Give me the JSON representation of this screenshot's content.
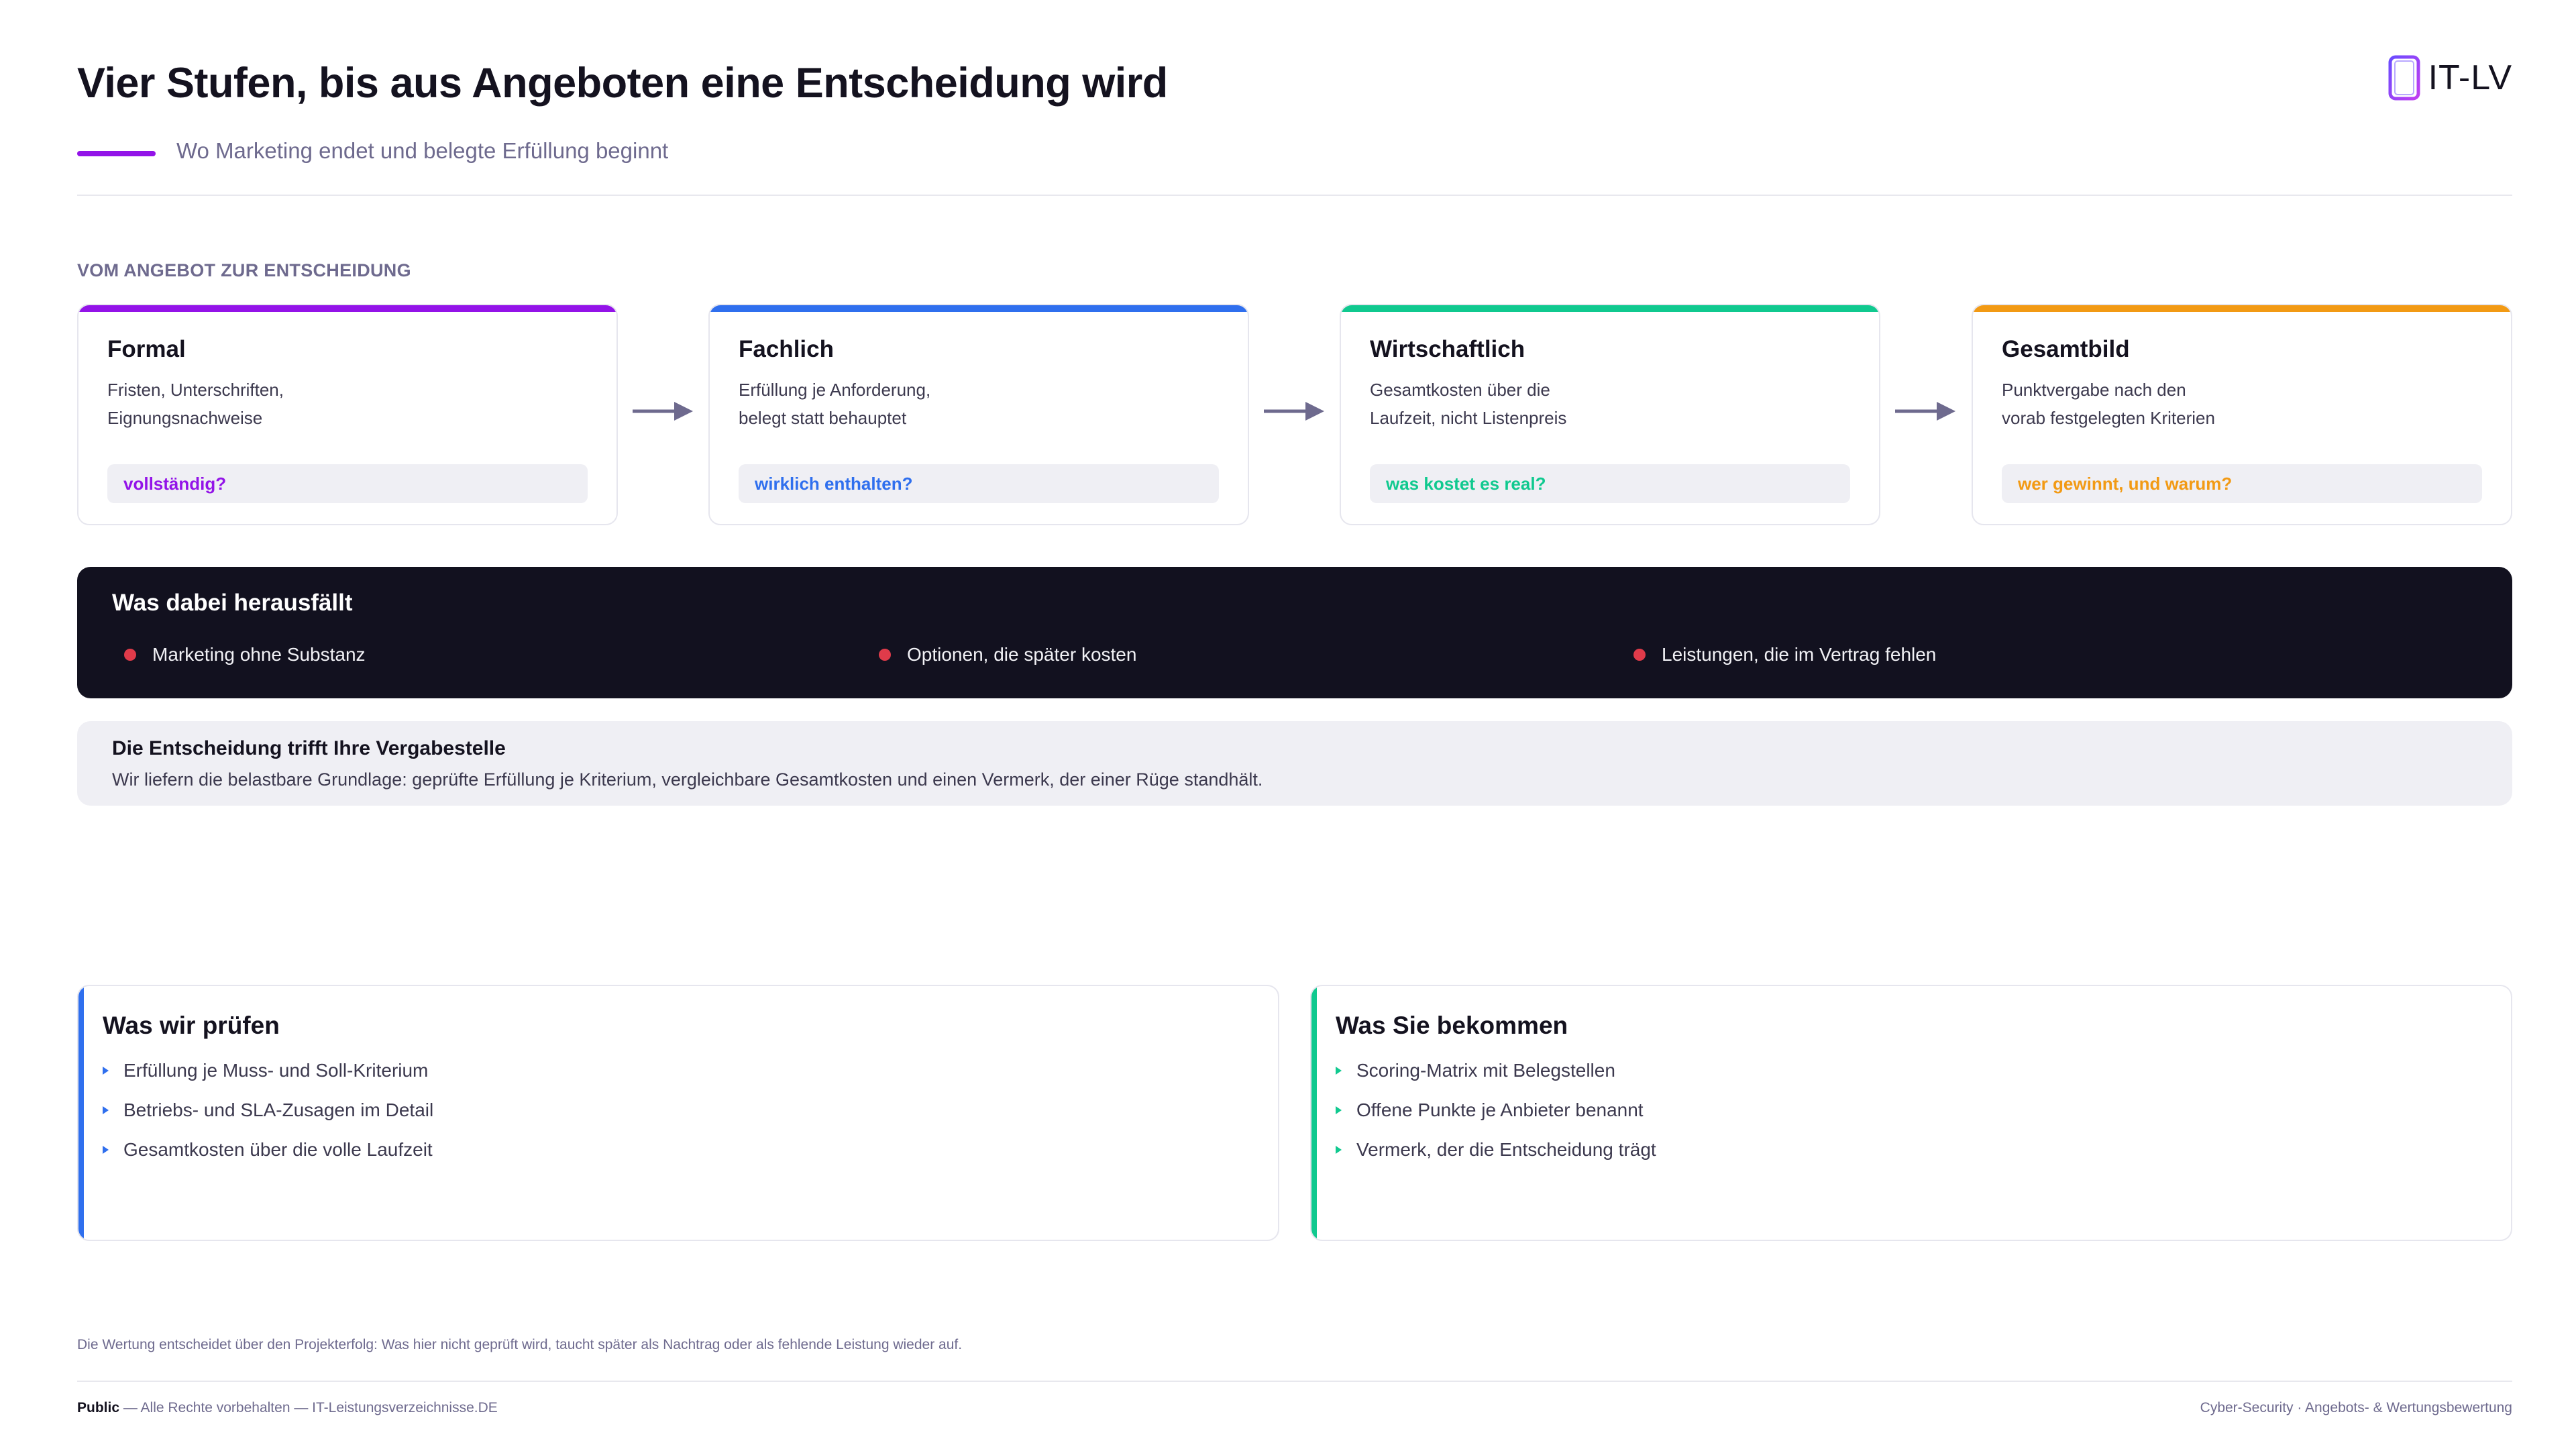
{
  "header": {
    "title": "Vier Stufen, bis aus Angeboten eine Entscheidung wird",
    "subtitle": "Wo Marketing endet und belegte Erfüllung beginnt",
    "logo_text": "IT-LV",
    "accent_color": "#9313e8"
  },
  "section_label": "VOM ANGEBOT ZUR ENTSCHEIDUNG",
  "stages": [
    {
      "title": "Formal",
      "desc_line1": "Fristen, Unterschriften,",
      "desc_line2": "Eignungsnachweise",
      "question": "vollständig?",
      "color": "#9313e8"
    },
    {
      "title": "Fachlich",
      "desc_line1": "Erfüllung je Anforderung,",
      "desc_line2": "belegt statt behauptet",
      "question": "wirklich enthalten?",
      "color": "#2f6fee"
    },
    {
      "title": "Wirtschaftlich",
      "desc_line1": "Gesamtkosten über die",
      "desc_line2": "Laufzeit, nicht Listenpreis",
      "question": "was kostet es real?",
      "color": "#10c98f"
    },
    {
      "title": "Gesamtbild",
      "desc_line1": "Punktvergabe nach den",
      "desc_line2": "vorab festgelegten Kriterien",
      "question": "wer gewinnt, und warum?",
      "color": "#f29a14"
    }
  ],
  "banner": {
    "title": "Was dabei herausfällt",
    "items": [
      "Marketing ohne Substanz",
      "Optionen, die später kosten",
      "Leistungen, die im Vertrag fehlen"
    ]
  },
  "note": {
    "title": "Die Entscheidung trifft Ihre Vergabestelle",
    "text": "Wir liefern die belastbare Grundlage: geprüfte Erfüllung je Kriterium, vergleichbare Gesamtkosten und einen Vermerk, der einer Rüge standhält."
  },
  "panels": [
    {
      "title": "Was wir prüfen",
      "color": "#2f6fee",
      "items": [
        "Erfüllung je Muss- und Soll-Kriterium",
        "Betriebs- und SLA-Zusagen im Detail",
        "Gesamtkosten über die volle Laufzeit"
      ]
    },
    {
      "title": "Was Sie bekommen",
      "color": "#10c98f",
      "items": [
        "Scoring-Matrix mit Belegstellen",
        "Offene Punkte je Anbieter benannt",
        "Vermerk, der die Entscheidung trägt"
      ]
    }
  ],
  "footnote": "Die Wertung entscheidet über den Projekterfolg: Was hier nicht geprüft wird, taucht später als Nachtrag oder als fehlende Leistung wieder auf.",
  "footer": {
    "classification": "Public",
    "left_text": " — Alle Rechte vorbehalten — IT-Leistungsverzeichnisse.DE",
    "right_text": "Cyber-Security · Angebots- & Wertungsbewertung"
  }
}
